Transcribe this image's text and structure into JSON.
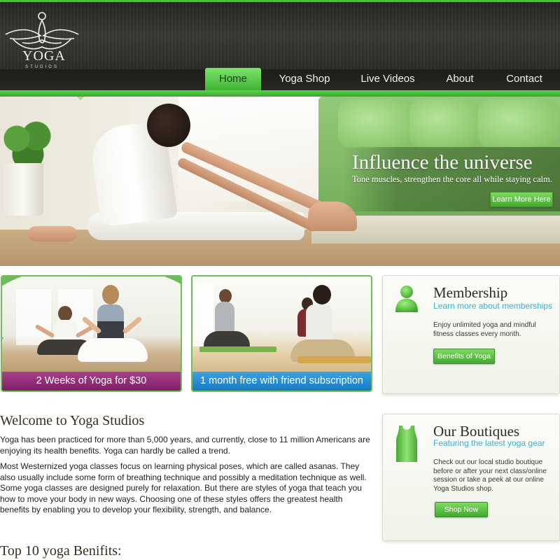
{
  "logo": {
    "word": "YOGA",
    "sub": "STUDIOS"
  },
  "nav": {
    "items": [
      {
        "label": "Home",
        "active": true
      },
      {
        "label": "Yoga Shop",
        "active": false
      },
      {
        "label": "Live Videos",
        "active": false
      },
      {
        "label": "About",
        "active": false
      },
      {
        "label": "Contact",
        "active": false
      }
    ]
  },
  "hero": {
    "title": "Influence the universe",
    "subtitle": "Tone muscles, strengthen the core all while staying calm.",
    "button": "Learn More Here"
  },
  "promos": [
    {
      "label": "2 Weeks of Yoga for $30",
      "color": "#8e2a77"
    },
    {
      "label": "1 month free with friend subscription",
      "color": "#2490d8"
    }
  ],
  "membership": {
    "title": "Membership",
    "subtitle": "Learn more about memberships",
    "text": "Enjoy unlimited yoga and mindful fitness classes every month.",
    "button": "Benefits of Yoga"
  },
  "boutiques": {
    "title": "Our Boutiques",
    "subtitle": "Featuring the latest yoga gear",
    "text": "Check out our local studio boutique before or after your next class/online session or take a peek at our online Yoga Studios shop.",
    "button": "Shop Now"
  },
  "article": {
    "title": "Welcome to Yoga Studios",
    "para1": "Yoga has been practiced for more than 5,000 years, and currently, close to 11 million Americans are enjoying its health benefits. Yoga can hardly be called a trend.",
    "para2": "Most Westernized yoga classes focus on learning physical poses, which are called asanas. They also usually include some form of breathing technique and possibly a meditation technique as well. Some yoga classes are designed purely for relaxation. But there are styles of yoga that teach you how to move your body in new ways. Choosing one of these styles offers the greatest health benefits by enabling you to develop your flexibility, strength, and balance.",
    "benefits_title": "Top 10 yoga Benifits:"
  },
  "colors": {
    "accent_green": "#4cbf3c",
    "link_blue": "#3eaed4",
    "header_dark": "#2c2c28"
  }
}
